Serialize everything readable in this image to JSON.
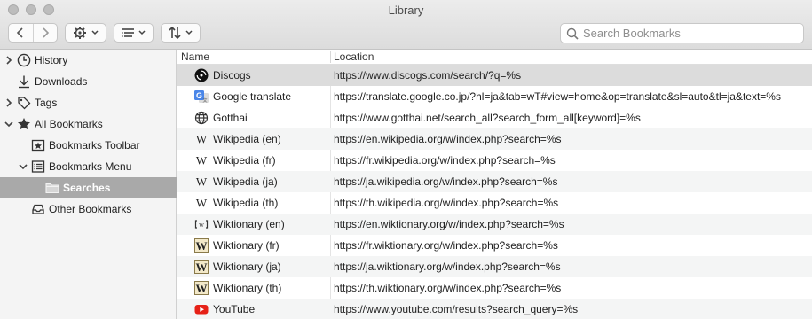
{
  "window": {
    "title": "Library"
  },
  "toolbar": {
    "back_icon": "chevron-left-icon",
    "forward_icon": "chevron-right-icon",
    "actions_icon": "gear-icon",
    "views_icon": "list-icon",
    "import_export_icon": "sort-arrows-icon"
  },
  "search": {
    "placeholder": "Search Bookmarks",
    "value": ""
  },
  "sidebar": {
    "items": [
      {
        "label": "History",
        "icon": "clock-icon",
        "disclosure": "collapsed",
        "level": 0
      },
      {
        "label": "Downloads",
        "icon": "download-icon",
        "disclosure": "none",
        "level": 0
      },
      {
        "label": "Tags",
        "icon": "tag-icon",
        "disclosure": "collapsed",
        "level": 0
      },
      {
        "label": "All Bookmarks",
        "icon": "star-icon",
        "disclosure": "expanded",
        "level": 0
      },
      {
        "label": "Bookmarks Toolbar",
        "icon": "bookmarks-toolbar-icon",
        "disclosure": "none",
        "level": 1
      },
      {
        "label": "Bookmarks Menu",
        "icon": "bookmarks-menu-icon",
        "disclosure": "expanded",
        "level": 1
      },
      {
        "label": "Searches",
        "icon": "folder-icon",
        "disclosure": "none",
        "level": 2,
        "selected": true
      },
      {
        "label": "Other Bookmarks",
        "icon": "inbox-icon",
        "disclosure": "none",
        "level": 1
      }
    ]
  },
  "table": {
    "columns": [
      "Name",
      "Location"
    ],
    "rows": [
      {
        "name": "Discogs",
        "location": "https://www.discogs.com/search/?q=%s",
        "icon": "discogs-icon",
        "selected": true
      },
      {
        "name": "Google translate",
        "location": "https://translate.google.co.jp/?hl=ja&tab=wT#view=home&op=translate&sl=auto&tl=ja&text=%s",
        "icon": "google-translate-icon"
      },
      {
        "name": "Gotthai",
        "location": "https://www.gotthai.net/search_all?search_form_all[keyword]=%s",
        "icon": "globe-icon"
      },
      {
        "name": "Wikipedia (en)",
        "location": "https://en.wikipedia.org/w/index.php?search=%s",
        "icon": "wikipedia-icon"
      },
      {
        "name": "Wikipedia (fr)",
        "location": "https://fr.wikipedia.org/w/index.php?search=%s",
        "icon": "wikipedia-icon"
      },
      {
        "name": "Wikipedia (ja)",
        "location": "https://ja.wikipedia.org/w/index.php?search=%s",
        "icon": "wikipedia-icon"
      },
      {
        "name": "Wikipedia (th)",
        "location": "https://th.wikipedia.org/w/index.php?search=%s",
        "icon": "wikipedia-icon"
      },
      {
        "name": "Wiktionary (en)",
        "location": "https://en.wiktionary.org/w/index.php?search=%s",
        "icon": "wiktionary-en-icon"
      },
      {
        "name": "Wiktionary (fr)",
        "location": "https://fr.wiktionary.org/w/index.php?search=%s",
        "icon": "wiktionary-icon"
      },
      {
        "name": "Wiktionary (ja)",
        "location": "https://ja.wiktionary.org/w/index.php?search=%s",
        "icon": "wiktionary-icon"
      },
      {
        "name": "Wiktionary (th)",
        "location": "https://th.wiktionary.org/w/index.php?search=%s",
        "icon": "wiktionary-icon"
      },
      {
        "name": "YouTube",
        "location": "https://www.youtube.com/results?search_query=%s",
        "icon": "youtube-icon"
      }
    ]
  },
  "colors": {
    "sidebar_selected": "#a9a9a9",
    "row_selected": "#dcdcdc",
    "youtube_red": "#e62117",
    "google_blue": "#4a86e8"
  }
}
